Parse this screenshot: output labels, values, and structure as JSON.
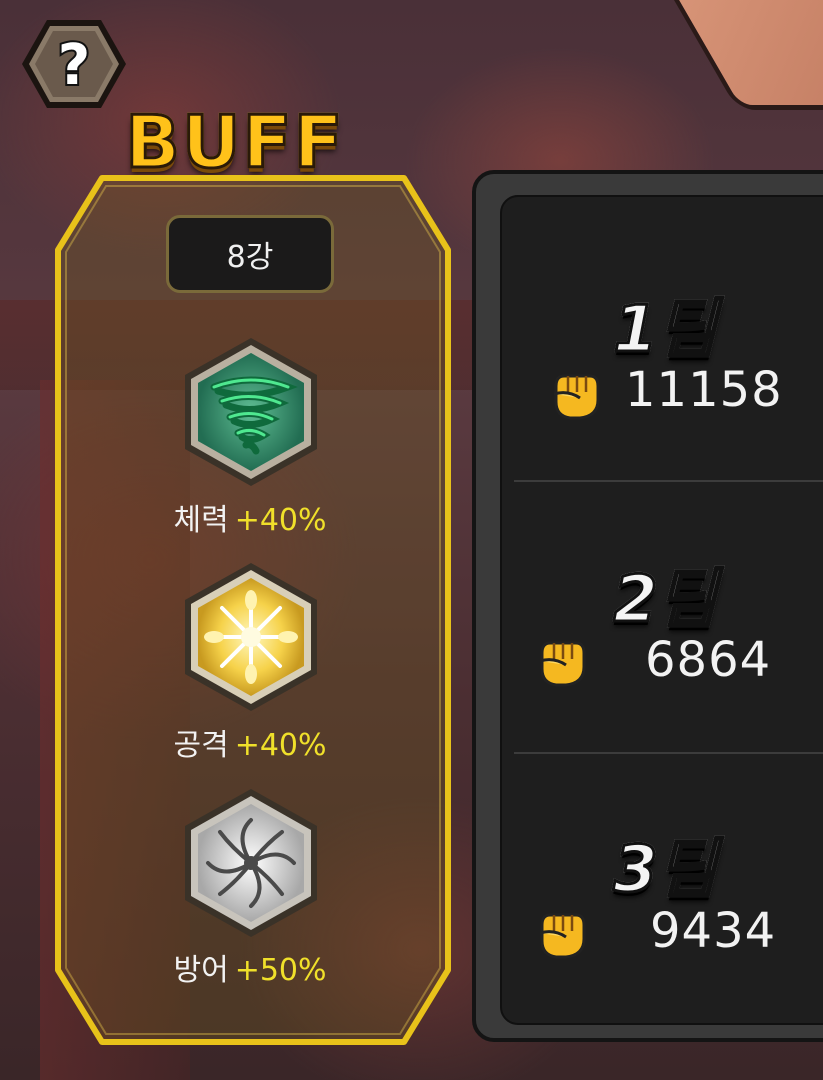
{
  "buff": {
    "title": "BUFF",
    "level": "8강",
    "items": [
      {
        "icon": "tornado-icon",
        "name": "체력",
        "value": "+40%"
      },
      {
        "icon": "star-burst-icon",
        "name": "공격",
        "value": "+40%"
      },
      {
        "icon": "swirl-shield-icon",
        "name": "방어",
        "value": "+50%"
      }
    ]
  },
  "teams": [
    {
      "name": "1팀",
      "power": "11158"
    },
    {
      "name": "2팀",
      "power": "6864"
    },
    {
      "name": "3팀",
      "power": "9434"
    }
  ],
  "colors": {
    "buff_title": "#ffc21a",
    "buff_value": "#f0e02a",
    "frame_gold": "#e8c21a",
    "team_panel": "#1e1e1e"
  }
}
